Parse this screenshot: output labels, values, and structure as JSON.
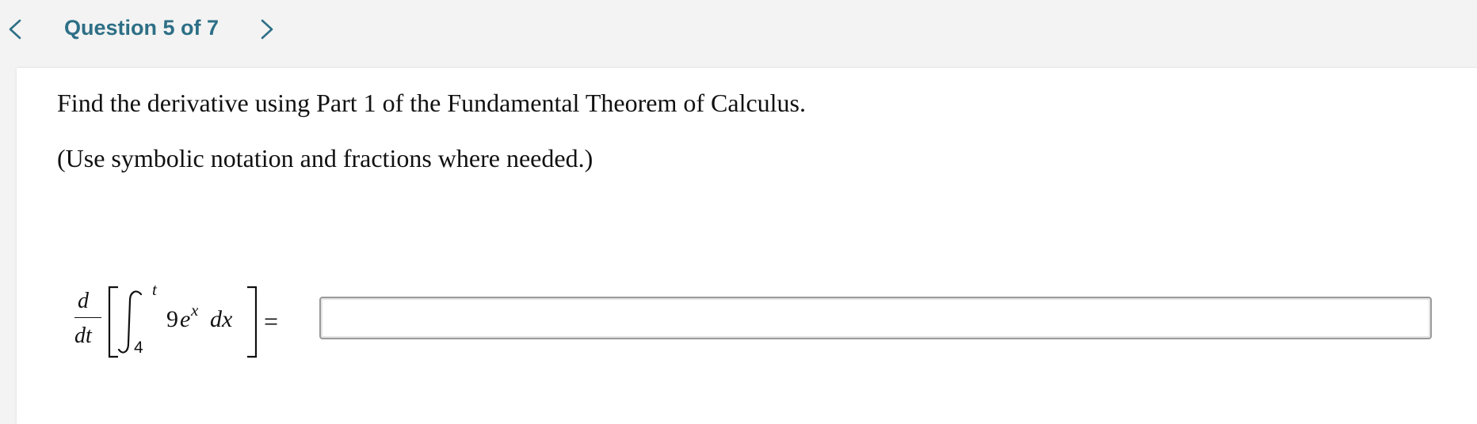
{
  "header": {
    "question_label": "Question 5 of 7",
    "prev_icon": "chevron-left-icon",
    "next_icon": "chevron-right-icon",
    "accent_color": "#2d6f86"
  },
  "question": {
    "instruction": "Find the derivative using Part 1 of the Fundamental Theorem of Calculus.",
    "hint": "(Use symbolic notation and fractions where needed.)",
    "expression": {
      "numerator": "d",
      "denominator": "dt",
      "upper_limit": "t",
      "lower_limit": "4",
      "coefficient": "9",
      "base": "e",
      "exponent": "x",
      "differential": "dx",
      "equals": "="
    },
    "answer": {
      "value": "",
      "placeholder": ""
    }
  }
}
